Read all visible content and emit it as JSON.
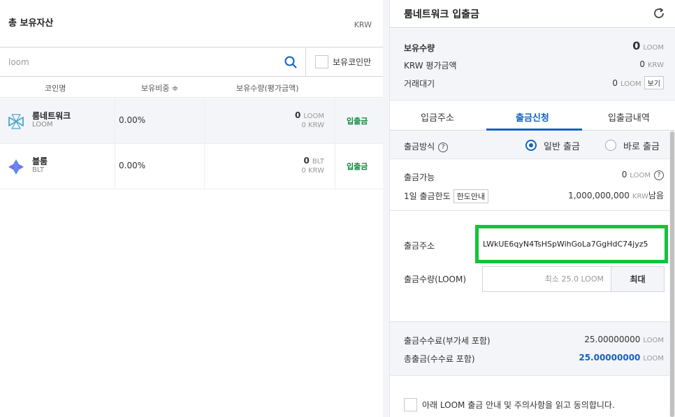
{
  "left": {
    "title": "총 보유자산",
    "currency": "KRW",
    "search_placeholder": "loom",
    "owned_only_label": "보유코인만",
    "columns": {
      "coin_name": "코인명",
      "ratio": "보유비중 ≑",
      "amount": "보유수량(평가금액)"
    },
    "rows": [
      {
        "name": "룸네트워크",
        "symbol": "LOOM",
        "ratio": "0.00%",
        "amount": "0",
        "unit": "LOOM",
        "krw": "0",
        "krw_unit": "KRW",
        "action": "입출금"
      },
      {
        "name": "블룸",
        "symbol": "BLT",
        "ratio": "0.00%",
        "amount": "0",
        "unit": "BLT",
        "krw": "0",
        "krw_unit": "KRW",
        "action": "입출금"
      }
    ]
  },
  "right": {
    "title": "룸네트워크 입출금",
    "summary": {
      "holding_label": "보유수량",
      "holding_value": "0",
      "holding_unit": "LOOM",
      "krw_label": "KRW 평가금액",
      "krw_value": "0",
      "krw_unit": "KRW",
      "trade_label": "거래대기",
      "trade_value": "0",
      "trade_unit": "LOOM",
      "view_label": "보기"
    },
    "tabs": [
      "입금주소",
      "출금신청",
      "입출금내역"
    ],
    "active_tab": 1,
    "form": {
      "method_label": "출금방식",
      "method_general": "일반 출금",
      "method_instant": "바로 출금",
      "available_label": "출금가능",
      "available_value": "0",
      "available_unit": "LOOM",
      "limit_label": "1일 출금한도",
      "limit_button": "한도안내",
      "limit_value": "1,000,000,000",
      "limit_unit": "KRW",
      "limit_suffix": "남음",
      "address_label": "출금주소",
      "address_value": "LWkUE6qyN4TsHSpWihGoLa7GgHdC74jyz5",
      "amount_label": "출금수량(LOOM)",
      "amount_placeholder": "최소 25.0 LOOM",
      "max_button": "최대",
      "fee_label": "출금수수료(부가세 포함)",
      "fee_value": "25.00000000",
      "fee_unit": "LOOM",
      "total_label": "총출금(수수료 포함)",
      "total_value": "25.00000000",
      "total_unit": "LOOM",
      "agree_text": "아래 LOOM 출금 안내 및 주의사항을 읽고 동의합니다."
    }
  },
  "colors": {
    "accent": "#1261c4",
    "highlight_border": "#12c43a",
    "io_green": "#0a8a3a"
  }
}
